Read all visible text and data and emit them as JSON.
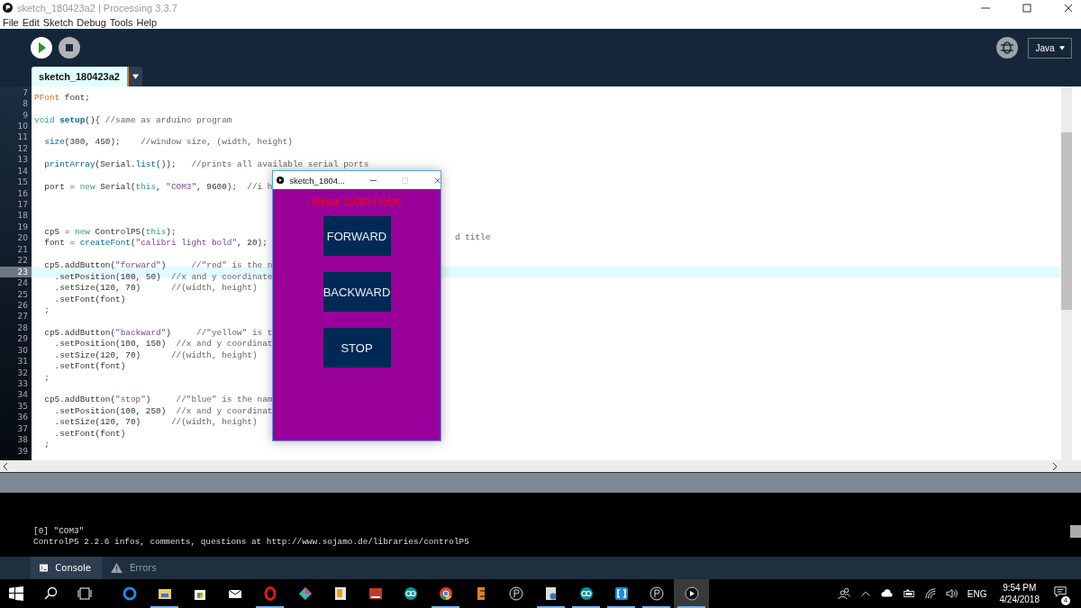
{
  "window": {
    "title": "sketch_180423a2 | Processing 3.3.7"
  },
  "menu": [
    "File",
    "Edit",
    "Sketch",
    "Debug",
    "Tools",
    "Help"
  ],
  "toolbar": {
    "mode": "Java"
  },
  "tabs": [
    {
      "label": "sketch_180423a2",
      "selected": true
    }
  ],
  "editor": {
    "lines": [
      {
        "number": "7",
        "current": false,
        "tokens": [
          {
            "kind": "type",
            "text": "PFont"
          },
          {
            "kind": "plain",
            "text": " font;"
          }
        ]
      },
      {
        "number": "8",
        "current": false
      },
      {
        "number": "9",
        "current": false,
        "tokens": [
          {
            "kind": "keyword",
            "text": "void "
          },
          {
            "kind": "method",
            "text": "setup"
          },
          {
            "kind": "plain",
            "text": "(){ "
          },
          {
            "kind": "comment",
            "text": "//same as arduino program"
          }
        ]
      },
      {
        "number": "10",
        "current": false
      },
      {
        "number": "11",
        "current": false,
        "tokens": [
          {
            "kind": "function",
            "text": "  size"
          },
          {
            "kind": "plain",
            "text": "(300, 450);    "
          },
          {
            "kind": "comment",
            "text": "//window size, (width, height)"
          }
        ]
      },
      {
        "number": "12",
        "current": false
      },
      {
        "number": "13",
        "current": false,
        "tokens": [
          {
            "kind": "function",
            "text": "  printArray"
          },
          {
            "kind": "plain",
            "text": "(Serial."
          },
          {
            "kind": "function",
            "text": "list"
          },
          {
            "kind": "plain",
            "text": "());   "
          },
          {
            "kind": "comment",
            "text": "//prints all available serial ports"
          }
        ]
      },
      {
        "number": "14",
        "current": false
      },
      {
        "number": "15",
        "current": false,
        "tokens": [
          {
            "kind": "plain",
            "text": "  port = "
          },
          {
            "kind": "keyword",
            "text": "new"
          },
          {
            "kind": "plain",
            "text": " Serial("
          },
          {
            "kind": "keyword",
            "text": "this"
          },
          {
            "kind": "plain",
            "text": ", "
          },
          {
            "kind": "string",
            "text": "\"COM3\""
          },
          {
            "kind": "plain",
            "text": ", 9600);  "
          },
          {
            "kind": "comment",
            "text": "//i h"
          }
        ]
      },
      {
        "number": "16",
        "current": false
      },
      {
        "number": "17",
        "current": false
      },
      {
        "number": "18",
        "current": false
      },
      {
        "number": "19",
        "current": false,
        "tokens": [
          {
            "kind": "plain",
            "text": "  cp5 = "
          },
          {
            "kind": "keyword",
            "text": "new"
          },
          {
            "kind": "plain",
            "text": " ControlP5("
          },
          {
            "kind": "keyword",
            "text": "this"
          },
          {
            "kind": "plain",
            "text": ");"
          }
        ]
      },
      {
        "number": "20",
        "current": false,
        "tokens": [
          {
            "kind": "plain",
            "text": "  font = "
          },
          {
            "kind": "function",
            "text": "createFont"
          },
          {
            "kind": "plain",
            "text": "("
          },
          {
            "kind": "string",
            "text": "\"calibri light bold\""
          },
          {
            "kind": "plain",
            "text": ", 20);"
          }
        ],
        "tail": "d title"
      },
      {
        "number": "21",
        "current": false
      },
      {
        "number": "22",
        "current": false,
        "tokens": [
          {
            "kind": "plain",
            "text": "  cp5.addButton("
          },
          {
            "kind": "string",
            "text": "\"forward\""
          },
          {
            "kind": "plain",
            "text": ")     "
          },
          {
            "kind": "comment",
            "text": "//\"red\" is the n"
          }
        ]
      },
      {
        "number": "23",
        "current": true,
        "tokens": [
          {
            "kind": "plain",
            "text": "    .setPosition(100, 50)  "
          },
          {
            "kind": "comment",
            "text": "//x and y coordinate"
          }
        ]
      },
      {
        "number": "24",
        "current": false,
        "tokens": [
          {
            "kind": "plain",
            "text": "    .setSize(120, 70)      "
          },
          {
            "kind": "comment",
            "text": "//(width, height)"
          }
        ]
      },
      {
        "number": "25",
        "current": false,
        "tokens": [
          {
            "kind": "plain",
            "text": "    .setFont(font)"
          }
        ]
      },
      {
        "number": "26",
        "current": false,
        "tokens": [
          {
            "kind": "plain",
            "text": "  ;"
          }
        ]
      },
      {
        "number": "27",
        "current": false
      },
      {
        "number": "28",
        "current": false,
        "tokens": [
          {
            "kind": "plain",
            "text": "  cp5.addButton("
          },
          {
            "kind": "string",
            "text": "\"backward\""
          },
          {
            "kind": "plain",
            "text": ")     "
          },
          {
            "kind": "comment",
            "text": "//\"yellow\" is t"
          }
        ]
      },
      {
        "number": "29",
        "current": false,
        "tokens": [
          {
            "kind": "plain",
            "text": "    .setPosition(100, 150)  "
          },
          {
            "kind": "comment",
            "text": "//x and y coordinat"
          }
        ]
      },
      {
        "number": "30",
        "current": false,
        "tokens": [
          {
            "kind": "plain",
            "text": "    .setSize(120, 70)      "
          },
          {
            "kind": "comment",
            "text": "//(width, height)"
          }
        ]
      },
      {
        "number": "31",
        "current": false,
        "tokens": [
          {
            "kind": "plain",
            "text": "    .setFont(font)"
          }
        ]
      },
      {
        "number": "32",
        "current": false,
        "tokens": [
          {
            "kind": "plain",
            "text": "  ;"
          }
        ]
      },
      {
        "number": "33",
        "current": false
      },
      {
        "number": "34",
        "current": false,
        "tokens": [
          {
            "kind": "plain",
            "text": "  cp5.addButton("
          },
          {
            "kind": "string",
            "text": "\"stop\""
          },
          {
            "kind": "plain",
            "text": ")     "
          },
          {
            "kind": "comment",
            "text": "//\"blue\" is the nam"
          }
        ]
      },
      {
        "number": "35",
        "current": false,
        "tokens": [
          {
            "kind": "plain",
            "text": "    .setPosition(100, 250)  "
          },
          {
            "kind": "comment",
            "text": "//x and y coordinat"
          }
        ]
      },
      {
        "number": "36",
        "current": false,
        "tokens": [
          {
            "kind": "plain",
            "text": "    .setSize(120, 70)      "
          },
          {
            "kind": "comment",
            "text": "//(width, height)"
          }
        ]
      },
      {
        "number": "37",
        "current": false,
        "tokens": [
          {
            "kind": "plain",
            "text": "    .setFont(font)"
          }
        ]
      },
      {
        "number": "38",
        "current": false,
        "tokens": [
          {
            "kind": "plain",
            "text": "  ;"
          }
        ]
      },
      {
        "number": "39",
        "current": false
      }
    ]
  },
  "sketch_window": {
    "title": "sketch_1804...",
    "heading": "Motor CONTROL",
    "buttons": [
      "FORWARD",
      "BACKWARD",
      "STOP"
    ]
  },
  "console": {
    "lines": [
      "[0] \"COM3\"",
      "ControlP5 2.2.6 infos, comments, questions at http://www.sojamo.de/libraries/controlP5"
    ]
  },
  "console_tabs": [
    {
      "label": "Console",
      "kind": "console",
      "selected": true
    },
    {
      "label": "Errors",
      "kind": "errors",
      "selected": false
    }
  ],
  "taskbar": {
    "apps": [
      {
        "kind": "edge",
        "running": false,
        "selected": false
      },
      {
        "kind": "folder",
        "running": true,
        "selected": false
      },
      {
        "kind": "store",
        "running": false,
        "selected": false
      },
      {
        "kind": "mail",
        "running": false,
        "selected": false
      },
      {
        "kind": "opera",
        "running": true,
        "selected": false
      },
      {
        "kind": "diamond",
        "running": false,
        "selected": false
      },
      {
        "kind": "doc",
        "running": false,
        "selected": false
      },
      {
        "kind": "tile",
        "running": false,
        "selected": false
      },
      {
        "kind": "infinity",
        "running": false,
        "selected": false
      },
      {
        "kind": "chrome",
        "running": true,
        "selected": false
      },
      {
        "kind": "wood",
        "running": false,
        "selected": false
      },
      {
        "kind": "p3",
        "running": false,
        "selected": false
      },
      {
        "kind": "doc2",
        "running": true,
        "selected": false
      },
      {
        "kind": "infinity",
        "running": true,
        "selected": false
      },
      {
        "kind": "brackets",
        "running": true,
        "selected": false
      },
      {
        "kind": "p3",
        "running": true,
        "selected": false
      },
      {
        "kind": "play",
        "running": true,
        "selected": true
      }
    ],
    "language": "ENG",
    "time": "9:54 PM",
    "date": "4/24/2018",
    "notifications": "4"
  }
}
